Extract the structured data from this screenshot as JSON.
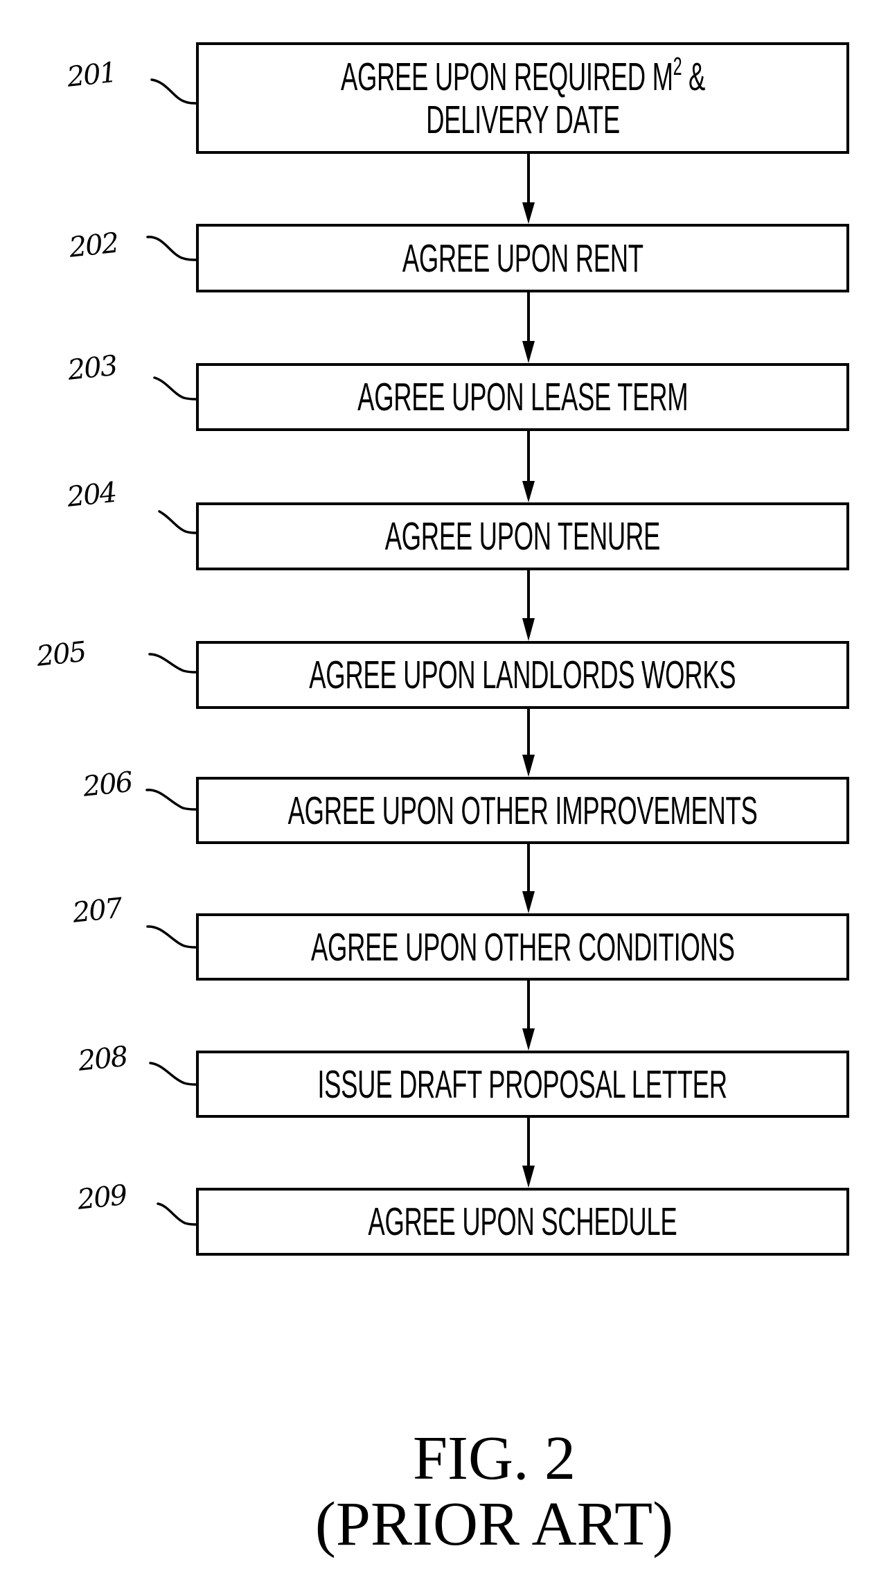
{
  "figure": {
    "title": "FIG. 2",
    "subtitle": "(PRIOR ART)"
  },
  "steps": [
    {
      "ref": "201",
      "text_main": "AGREE UPON REQUIRED M",
      "text_sup": "2",
      "text_after": " &",
      "text_line2": "DELIVERY DATE"
    },
    {
      "ref": "202",
      "text": "AGREE UPON RENT"
    },
    {
      "ref": "203",
      "text": "AGREE UPON LEASE TERM"
    },
    {
      "ref": "204",
      "text": "AGREE UPON TENURE"
    },
    {
      "ref": "205",
      "text": "AGREE UPON LANDLORDS WORKS"
    },
    {
      "ref": "206",
      "text": "AGREE UPON OTHER IMPROVEMENTS"
    },
    {
      "ref": "207",
      "text": "AGREE UPON OTHER CONDITIONS"
    },
    {
      "ref": "208",
      "text": "ISSUE DRAFT PROPOSAL LETTER"
    },
    {
      "ref": "209",
      "text": "AGREE UPON SCHEDULE"
    }
  ],
  "colors": {
    "ink": "#000000",
    "background": "#ffffff"
  }
}
